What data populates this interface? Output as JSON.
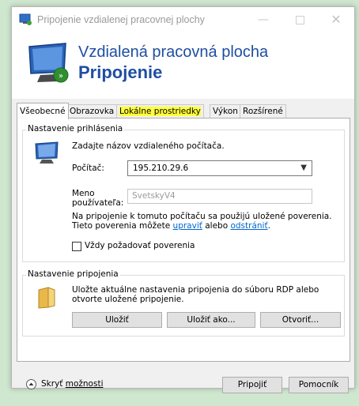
{
  "window": {
    "title": "Pripojenie vzdialenej pracovnej plochy"
  },
  "header": {
    "line1": "Vzdialená pracovná plocha",
    "line2": "Pripojenie"
  },
  "tabs": [
    {
      "label": "Všeobecné",
      "active": true
    },
    {
      "label": "Obrazovka"
    },
    {
      "label": "Lokálne prostriedky",
      "highlight_color": "#ffff3c"
    },
    {
      "label": "Výkon"
    },
    {
      "label": "Rozšírené"
    }
  ],
  "logon": {
    "group_label": "Nastavenie prihlásenia",
    "instruction": "Zadajte názov vzdialeného počítača.",
    "computer_label": "Počítač:",
    "computer_value": "195.210.29.6",
    "user_label_line1": "Meno",
    "user_label_line2": "používateľa:",
    "user_value": "SvetskyV4",
    "info_line1": "Na pripojenie k tomuto počítaču sa použijú uložené poverenia.",
    "info_line2_prefix": "Tieto poverenia môžete ",
    "edit_link": "upraviť",
    "info_line2_middle": " alebo ",
    "delete_link": "odstrániť",
    "info_line2_suffix": ".",
    "always_ask_label": "Vždy požadovať poverenia"
  },
  "connection": {
    "group_label": "Nastavenie pripojenia",
    "text_line1": "Uložte aktuálne nastavenia pripojenia do súboru RDP alebo",
    "text_line2": "otvorte uložené pripojenie.",
    "save_label": "Uložiť",
    "save_as_label": "Uložiť ako...",
    "open_label": "Otvoriť..."
  },
  "footer": {
    "hide_prefix": "Skryť ",
    "hide_underlined": "možnosti",
    "connect_label": "Pripojiť",
    "help_label": "Pomocník"
  },
  "colors": {
    "accent": "#1f4ea1",
    "link": "#0066cc"
  }
}
